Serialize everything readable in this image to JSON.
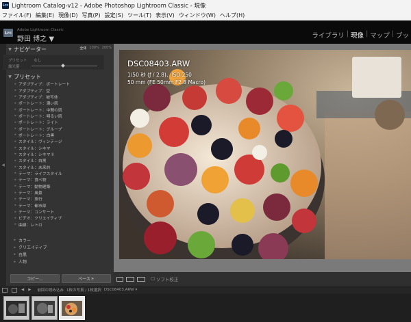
{
  "window": {
    "title": "Lightroom Catalog-v12 - Adobe Photoshop Lightroom Classic - 現像",
    "app_icon": "Lrc"
  },
  "menu": [
    "ファイル(F)",
    "編集(E)",
    "現像(D)",
    "写真(P)",
    "設定(S)",
    "ツール(T)",
    "表示(V)",
    "ウィンドウ(W)",
    "ヘルプ(H)"
  ],
  "identity": {
    "logo": "Lrc",
    "product": "Adobe Lightroom Classic",
    "user": "野田 博之 ▼"
  },
  "modules": {
    "library": "ライブラリ",
    "develop": "現像",
    "map": "マップ",
    "book": "ブッ",
    "separator": "|"
  },
  "navigator": {
    "title": "ナビゲーター",
    "sizes": [
      "全体",
      "100%",
      "200%"
    ],
    "row1_label": "プリセット",
    "row1_value": "なし",
    "row2_label": "露光量",
    "row2_value": ""
  },
  "presets": {
    "title": "プリセット",
    "items": [
      "アダプティブ：ポートレート",
      "アダプティブ：空",
      "アダプティブ：被写体",
      "ポートレート：濃い肌",
      "ポートレート：中間の肌",
      "ポートレート：明るい肌",
      "ポートレート：ライト",
      "ポートレート：グループ",
      "ポートレート：白黒",
      "スタイル：ヴィンテージ",
      "スタイル：シネマ",
      "スタイル：シネマ II",
      "スタイル：白黒",
      "スタイル：未来的",
      "テーマ：ライフスタイル",
      "テーマ：食べ物",
      "テーマ：動物建築",
      "テーマ：風景",
      "テーマ：旅行",
      "テーマ：都市部",
      "テーマ：コンサート",
      "ビデオ：クリエイティブ",
      "曲線：レトロ"
    ],
    "groups": [
      "カラー",
      "クリエイティブ",
      "白黒",
      "人物"
    ]
  },
  "buttons": {
    "copy": "コピー...",
    "paste": "ペースト"
  },
  "photo": {
    "filename": "DSC08403.ARW",
    "exposure": "1/50 秒 (ƒ / 2.8)、ISO 250",
    "lens": "50 mm (FE 50mm F2.8 Macro)"
  },
  "toolbar": {
    "softproof": "ソフト校正"
  },
  "filmstrip": {
    "source": "前回の読み込み",
    "count": "1枚の写真 / 1枚選択",
    "path": "DSC08403.ARW"
  },
  "colors": {
    "accent": "#f0f0f0",
    "panel": "#333333",
    "work": "#7a7a7a"
  },
  "icons": [
    "grid-icon",
    "loupe-icon",
    "compare-icon",
    "back-arrow-icon",
    "forward-arrow-icon"
  ]
}
